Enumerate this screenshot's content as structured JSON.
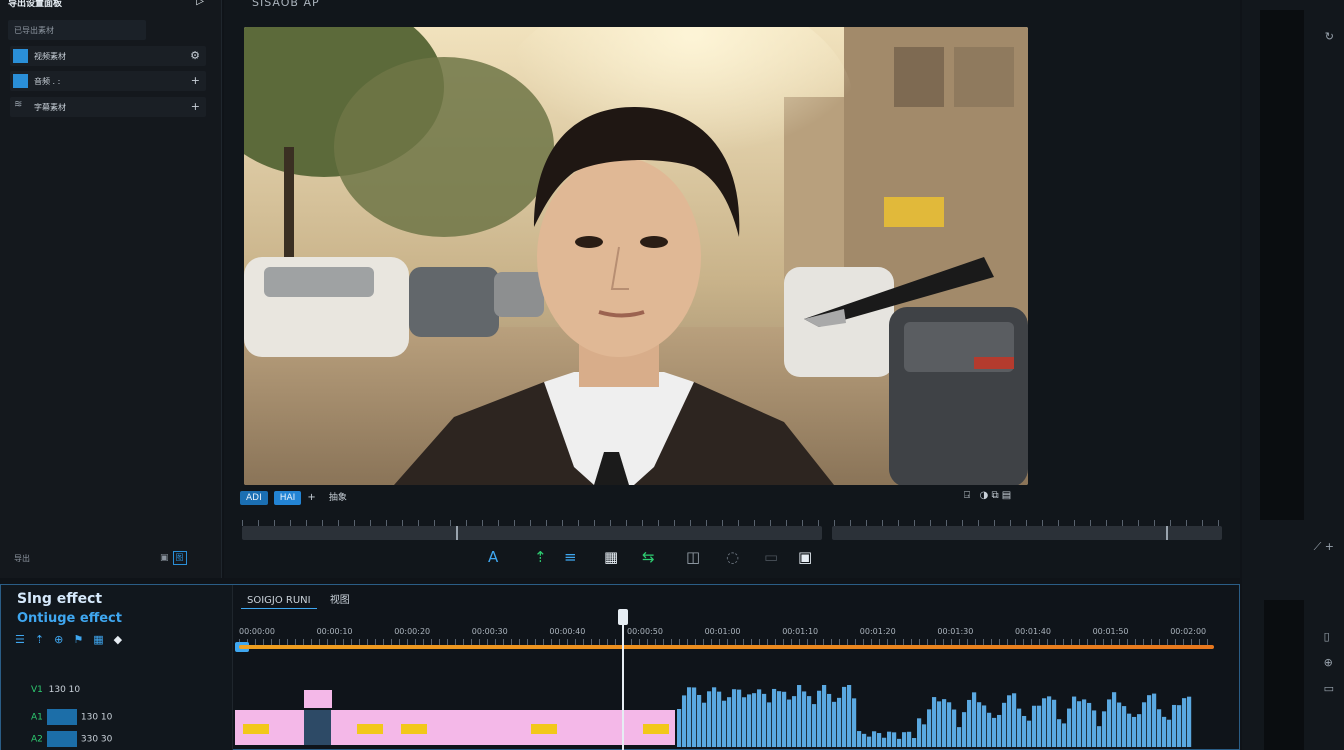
{
  "left_panel": {
    "title": "导出设置面板",
    "search": "已导出素材",
    "items": [
      {
        "label": "视频素材",
        "icon": "swatch",
        "action": "⚙"
      },
      {
        "label": "音频 . :",
        "icon": "swatch",
        "action": "+"
      },
      {
        "label": "字幕素材",
        "icon": "≋",
        "action": "+"
      }
    ],
    "footer_left": "导出",
    "footer_right": "图"
  },
  "viewer": {
    "title": "SISAOB AP",
    "controls": {
      "btn1": "ADI",
      "btn2": "HAI",
      "plus": "+",
      "label": "抽象"
    },
    "tools": [
      "A",
      "⇡",
      "≡",
      "▦",
      "⇆",
      "◫",
      "◌",
      "▭",
      "▣"
    ]
  },
  "timeline": {
    "effect_title": "Slng effect",
    "effect_subtitle": "Ontiuge effect",
    "tab_active": "SOIGJO RUNI",
    "tab2": "视图",
    "timestamps": [
      "00:00:00",
      "00:00:10",
      "00:00:20",
      "00:00:30",
      "00:00:40",
      "00:00:50",
      "00:01:00",
      "00:01:10",
      "00:01:20",
      "00:01:30",
      "00:01:40",
      "00:01:50",
      "00:02:00"
    ],
    "tracks": [
      {
        "name": "V1",
        "value": "130 10"
      },
      {
        "name": "A1",
        "value": "130 10"
      },
      {
        "name": "A2",
        "value": "330 30"
      }
    ]
  },
  "colors": {
    "accent": "#2a8fd8",
    "clip_pink": "#f4b8e8",
    "timeline_orange": "#f0a020",
    "wave_blue": "#5aa8e0"
  }
}
